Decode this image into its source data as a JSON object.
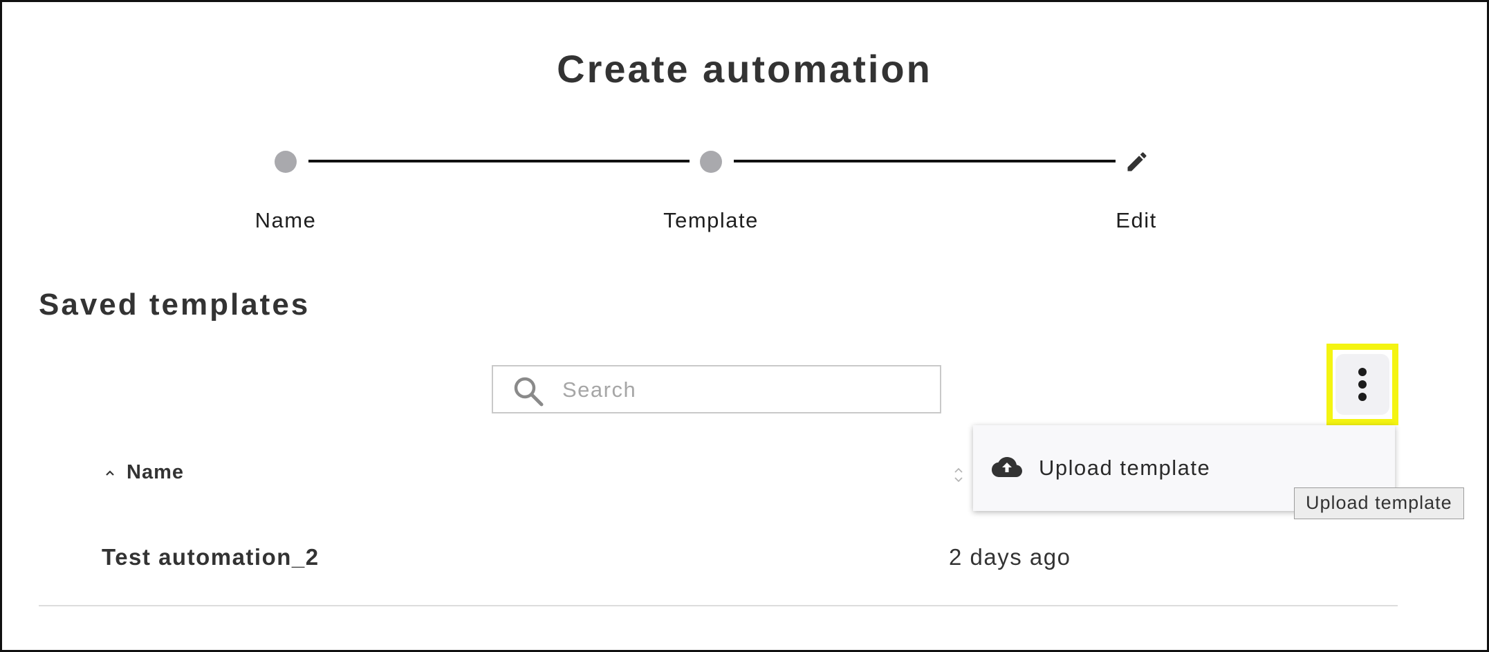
{
  "page": {
    "title": "Create automation"
  },
  "stepper": {
    "steps": [
      {
        "label": "Name",
        "state": "completed"
      },
      {
        "label": "Template",
        "state": "completed"
      },
      {
        "label": "Edit",
        "state": "current",
        "icon": "pencil-icon"
      }
    ]
  },
  "saved_templates": {
    "title": "Saved templates",
    "search": {
      "placeholder": "Search",
      "value": "",
      "icon": "search-icon"
    },
    "more_button": {
      "icon": "more-vertical-icon",
      "highlighted": true,
      "highlight_color": "#f4f411"
    },
    "menu": {
      "items": [
        {
          "label": "Upload template",
          "icon": "cloud-upload-icon"
        }
      ]
    },
    "tooltip": "Upload template",
    "table": {
      "columns": [
        {
          "label": "Name",
          "sort": "ascending"
        },
        {
          "label": "",
          "sort": "none"
        }
      ],
      "rows": [
        {
          "name": "Test automation_2",
          "modified": "2 days ago"
        }
      ]
    }
  },
  "colors": {
    "step_dot": "#a9a9ad",
    "step_line": "#111111",
    "text": "#333333",
    "highlight": "#f4f411"
  }
}
